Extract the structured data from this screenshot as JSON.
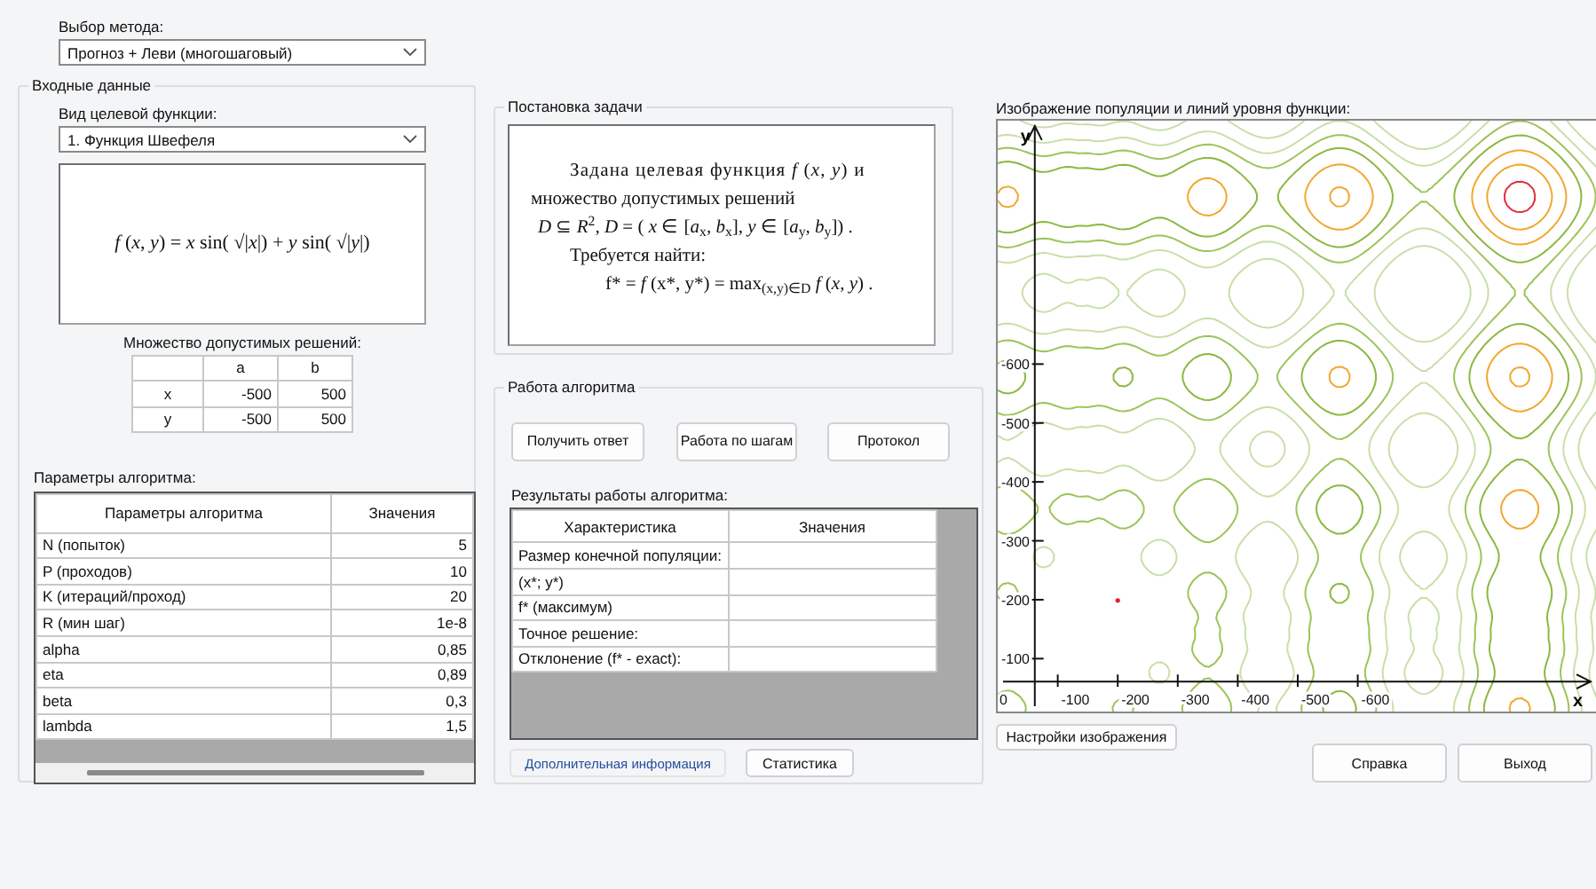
{
  "method": {
    "label": "Выбор метода:",
    "value": "Прогноз + Леви (многошаговый)"
  },
  "input_data": {
    "title": "Входные данные",
    "function_label": "Вид целевой функции:",
    "function_value": "1. Функция Швефеля",
    "formula": "*f* (*x*, *y*) = *x* sin( √|*x*|) + *y* sin( √|*y*|)",
    "domain": {
      "title": "Множество допустимых решений:",
      "columns": [
        "a",
        "b"
      ],
      "rows": [
        {
          "name": "x",
          "a": "-500",
          "b": "500"
        },
        {
          "name": "y",
          "a": "-500",
          "b": "500"
        }
      ]
    },
    "params": {
      "title": "Параметры алгоритма:",
      "columns": [
        "Параметры алгоритма",
        "Значения"
      ],
      "rows": [
        {
          "name": "N (попыток)",
          "value": "5"
        },
        {
          "name": "P (проходов)",
          "value": "10"
        },
        {
          "name": "K (итераций/проход)",
          "value": "20"
        },
        {
          "name": "R (мин шаг)",
          "value": "1e-8"
        },
        {
          "name": "alpha",
          "value": "0,85"
        },
        {
          "name": "eta",
          "value": "0,89"
        },
        {
          "name": "beta",
          "value": "0,3"
        },
        {
          "name": "lambda",
          "value": "1,5"
        }
      ]
    }
  },
  "problem": {
    "title": "Постановка задачи",
    "lines": [
      "Задана целевая функция *f* (*x*, *y*) и",
      "множество допустимых решений",
      "*D* ⊆ *R*$^{2}$, *D* = ( *x* ∈ [*a*$_{x}$, *b*$_{x}$], *y* ∈ [*a*$_{y}$, *b*$_{y}$]) .",
      "Требуется найти:",
      "f* = *f* (x*, y*) = max$_{(x,y)∈D}$ *f* (*x*, *y*) ."
    ]
  },
  "algorithm": {
    "title": "Работа алгоритма",
    "buttons": [
      "Получить ответ",
      "Работа по шагам",
      "Протокол"
    ],
    "results_title": "Результаты работы алгоритма:",
    "columns": [
      "Характеристика",
      "Значения"
    ],
    "rows": [
      "Размер конечной популяции:",
      "(x*; y*)",
      "f* (максимум)",
      "Точное решение:",
      "Отклонение (f* - exact):"
    ],
    "bottom_buttons": [
      {
        "label": "Дополнительная информация",
        "kind": "link"
      },
      {
        "label": "Статистика",
        "kind": "button"
      }
    ]
  },
  "plot": {
    "title": "Изображение популяции и линий уровня функции:",
    "y_label": "y",
    "x_label": "x",
    "y_ticks": [
      "-600",
      "-500",
      "-400",
      "-300",
      "-200",
      "-100"
    ],
    "x_ticks": [
      "0",
      "-100",
      "-200",
      "-300",
      "-400",
      "-500",
      "-600"
    ]
  },
  "settings_button": "Настройки изображения",
  "footer_buttons": [
    "Справка",
    "Выход"
  ]
}
